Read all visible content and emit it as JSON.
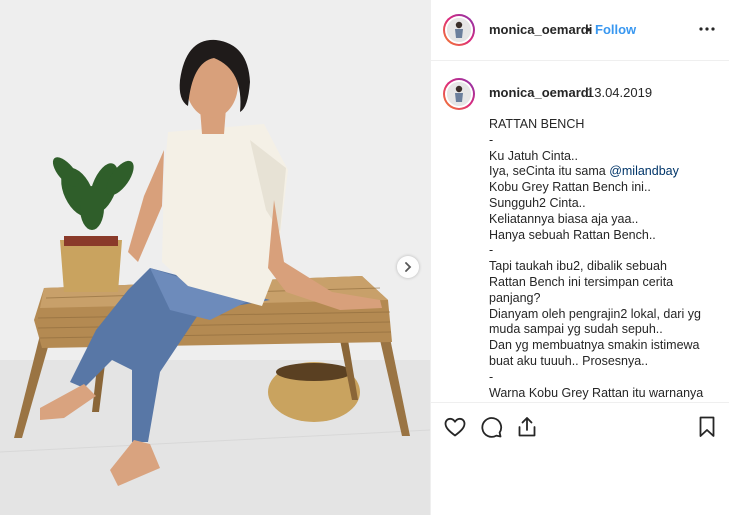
{
  "header": {
    "username": "monica_oemardi",
    "dot": "•",
    "follow_label": "Follow",
    "more_label": "•••"
  },
  "caption": {
    "username": "monica_oemardi",
    "date": "13.04.2019",
    "lines": [
      "RATTAN BENCH",
      "-",
      "Ku Jatuh Cinta..",
      "Iya, seCinta itu sama ",
      "Kobu Grey Rattan Bench ini..",
      "Sungguh2 Cinta..",
      "Keliatannya biasa aja yaa..",
      "Hanya sebuah Rattan Bench..",
      "-",
      "Tapi taukah ibu2, dibalik sebuah",
      "Rattan Bench ini tersimpan cerita",
      "panjang?",
      "Dianyam oleh pengrajin2 lokal, dari yg",
      "muda sampai yg sudah sepuh..",
      "Dan yg membuatnya smakin istimewa",
      "buat aku tuuuh.. Prosesnya..",
      "-",
      "Warna Kobu Grey Rattan itu warnanya"
    ],
    "mention": "@milandbay"
  },
  "actions": {
    "icons": [
      "heart-icon",
      "comment-icon",
      "share-icon",
      "bookmark-icon"
    ]
  },
  "colors": {
    "link": "#3897f0",
    "mention": "#003569",
    "text": "#262626",
    "border": "#efefef"
  }
}
